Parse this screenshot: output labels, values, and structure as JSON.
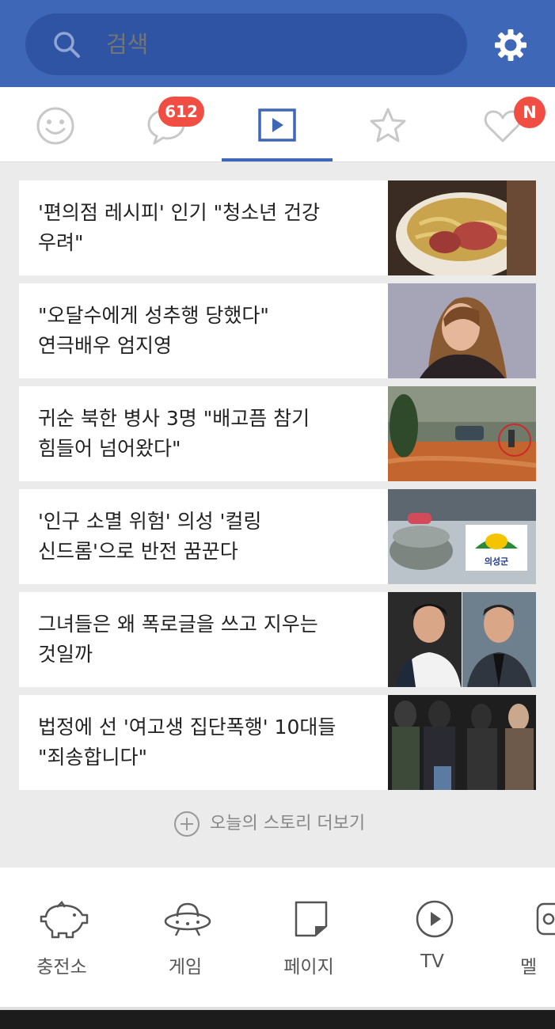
{
  "search": {
    "placeholder": "검색"
  },
  "tabs": {
    "items": [
      {
        "name": "emoticon",
        "icon": "smiley-icon"
      },
      {
        "name": "talk",
        "icon": "speech-bubble-icon",
        "badge": "612"
      },
      {
        "name": "video",
        "icon": "play-icon",
        "selected": true
      },
      {
        "name": "favorites",
        "icon": "star-icon"
      },
      {
        "name": "likes",
        "icon": "heart-icon",
        "badge": "N"
      }
    ]
  },
  "news": [
    {
      "title": "'편의점 레시피' 인기 \"청소년 건강\n우려\"",
      "thumb": "food-cup-thumbnail"
    },
    {
      "title": "\"오달수에게 성추행 당했다\"\n연극배우 엄지영",
      "thumb": "portrait-thumbnail"
    },
    {
      "title": "귀순 북한 병사 3명 \"배고픔 참기\n힘들어 넘어왔다\"",
      "thumb": "border-scene-thumbnail"
    },
    {
      "title": "'인구 소멸 위험' 의성 '컬링\n신드롬'으로 반전 꿈꾼다",
      "thumb": "curling-thumbnail",
      "thumb_text": "의성군"
    },
    {
      "title": "그녀들은 왜 폭로글을 쓰고 지우는\n것일까",
      "thumb": "two-men-thumbnail"
    },
    {
      "title": "법정에 선 '여고생 집단폭행' 10대들\n\"죄송합니다\"",
      "thumb": "group-thumbnail"
    }
  ],
  "more_label": "오늘의 스토리 더보기",
  "bottom_nav": [
    {
      "label": "충전소",
      "icon": "piggy-bank-icon"
    },
    {
      "label": "게임",
      "icon": "ufo-icon"
    },
    {
      "label": "페이지",
      "icon": "page-icon"
    },
    {
      "label": "TV",
      "icon": "tv-play-icon"
    },
    {
      "label": "멜",
      "icon": "melon-icon"
    }
  ],
  "colors": {
    "header": "#3e67b8",
    "search_bg": "#2f54a3",
    "badge": "#f04e43",
    "accent": "#3e67b8"
  }
}
